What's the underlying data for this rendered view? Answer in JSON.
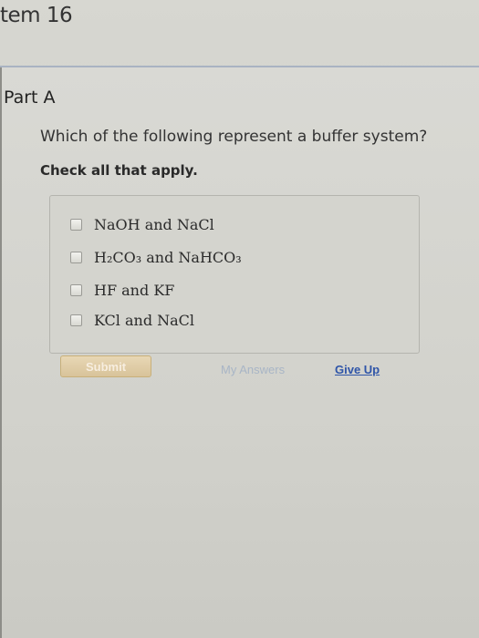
{
  "header": {
    "item_title": "tem 16"
  },
  "part": {
    "title": "Part A",
    "question": "Which of the following represent a buffer system?",
    "instruction": "Check all that apply."
  },
  "choices": [
    {
      "label": "NaOH and NaCl",
      "checked": false
    },
    {
      "label": "H₂CO₃ and NaHCO₃",
      "checked": false
    },
    {
      "label": "HF and KF",
      "checked": false
    },
    {
      "label": "KCl and NaCl",
      "checked": false
    }
  ],
  "actions": {
    "submit_label": "Submit",
    "my_answers_label": "My Answers",
    "give_up_label": "Give Up"
  },
  "colors": {
    "accent_link": "#2f55a8",
    "disabled_link": "#a8b5c6",
    "submit_bg": "#d8c39a"
  }
}
